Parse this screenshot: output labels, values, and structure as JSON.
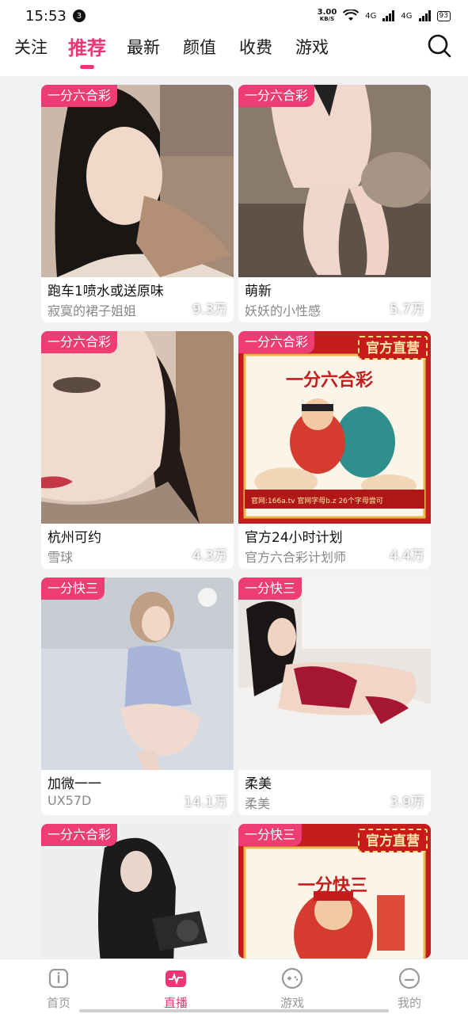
{
  "status": {
    "time": "15:53",
    "notif_count": "3",
    "net_speed": "3.00",
    "net_unit": "KB/S",
    "signal1": "4G",
    "signal2": "4G",
    "battery": "93"
  },
  "tabs": [
    "关注",
    "推荐",
    "最新",
    "颜值",
    "收费",
    "游戏"
  ],
  "active_tab": "推荐",
  "colors": {
    "accent": "#ec3774",
    "tag_bg": "#ee3c74",
    "official_bg": "#c81a1a"
  },
  "cards": [
    {
      "tag": "一分六合彩",
      "views": "9.3万",
      "title": "跑车1喷水或送原味",
      "subtitle": "寂寞的裙子姐姐",
      "official": ""
    },
    {
      "tag": "一分六合彩",
      "views": "5.7万",
      "title": "萌新",
      "subtitle": "妖妖的小性感",
      "official": ""
    },
    {
      "tag": "一分六合彩",
      "views": "4.3万",
      "title": "杭州可约",
      "subtitle": "雪球",
      "official": ""
    },
    {
      "tag": "一分六合彩",
      "views": "4.4万",
      "title": "官方24小时计划",
      "subtitle": "官方六合彩计划师",
      "official": "官方直营",
      "poster_title": "一分六合彩",
      "poster_footer": "官网:166a.tv 官网字母b.z 26个字母尝可"
    },
    {
      "tag": "一分快三",
      "views": "14.1万",
      "title": "加微一一",
      "subtitle": "UX57D",
      "official": ""
    },
    {
      "tag": "一分快三",
      "views": "3.9万",
      "title": "柔美",
      "subtitle": "柔美",
      "official": ""
    },
    {
      "tag": "一分六合彩",
      "views": "",
      "title": "",
      "subtitle": "",
      "official": ""
    },
    {
      "tag": "一分快三",
      "views": "",
      "title": "",
      "subtitle": "",
      "official": "官方直营",
      "poster_title": "一分快三"
    }
  ],
  "bottom_nav": [
    {
      "label": "首页",
      "icon": "home-icon"
    },
    {
      "label": "直播",
      "icon": "live-icon"
    },
    {
      "label": "游戏",
      "icon": "gamepad-icon"
    },
    {
      "label": "我的",
      "icon": "profile-icon"
    }
  ],
  "active_bottom": "直播"
}
